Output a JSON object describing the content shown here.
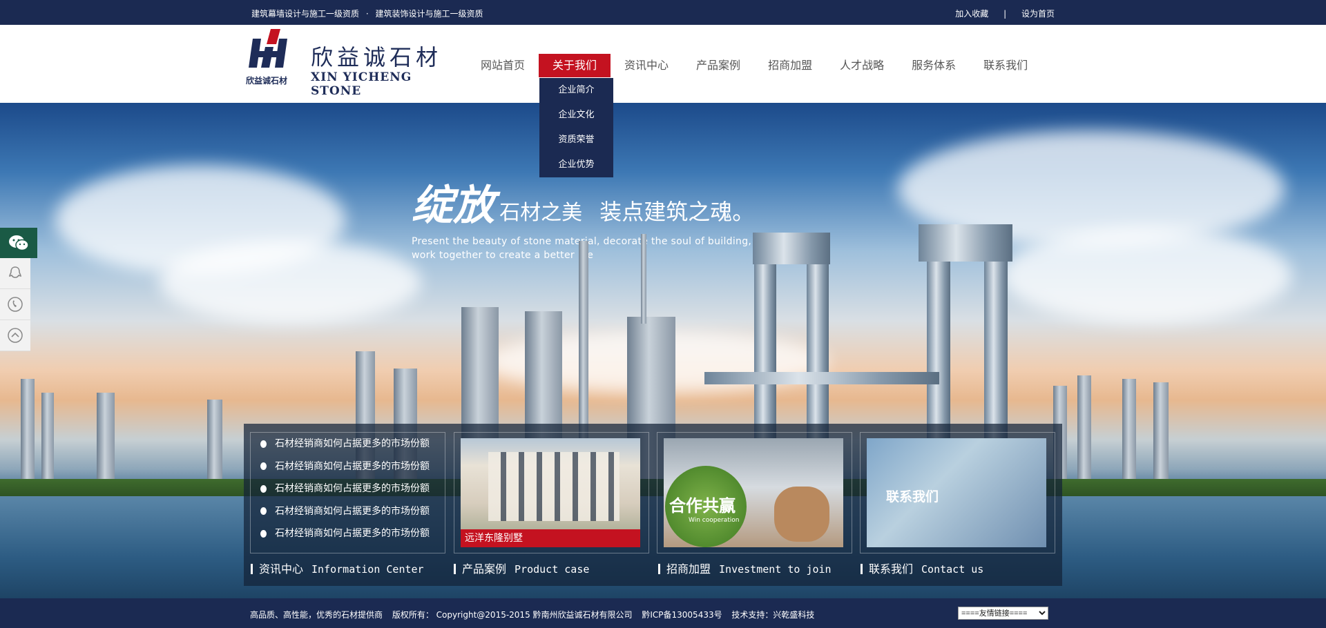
{
  "topbar": {
    "qual1": "建筑幕墙设计与施工一级资质",
    "dot": "·",
    "qual2": "建筑装饰设计与施工一级资质",
    "favorite": "加入收藏",
    "divider": "|",
    "homepage": "设为首页"
  },
  "logo": {
    "cn": "欣益诚石材",
    "en": "XIN YICHENG STONE",
    "sub": "欣益诚石材"
  },
  "nav": {
    "items": [
      "网站首页",
      "关于我们",
      "资讯中心",
      "产品案例",
      "招商加盟",
      "人才战略",
      "服务体系",
      "联系我们"
    ],
    "active_index": 1,
    "dropdown": [
      "企业简介",
      "企业文化",
      "资质荣誉",
      "企业优势"
    ]
  },
  "banner": {
    "slogan_big": "绽放",
    "slogan_1": "石材之美",
    "slogan_2": "装点建筑之魂。",
    "slogan_en1": "Present the beauty of stone material, decorate the soul of building,",
    "slogan_en2": "work together to create a better life"
  },
  "sidefloat": [
    "wechat-icon",
    "qq-icon",
    "phone-icon",
    "back-to-top-icon"
  ],
  "panel": {
    "news": [
      "石材经销商如何占据更多的市场份额",
      "石材经销商如何占据更多的市场份额",
      "石材经销商如何占据更多的市场份额",
      "石材经销商如何占据更多的市场份额",
      "石材经销商如何占据更多的市场份额"
    ],
    "product_caption": "远洋东隆别墅",
    "invest_text": "合作共赢",
    "invest_en": "Win cooperation",
    "contact_caption": "联系我们",
    "labels": [
      {
        "cn": "资讯中心",
        "en": "Information Center"
      },
      {
        "cn": "产品案例",
        "en": "Product case"
      },
      {
        "cn": "招商加盟",
        "en": "Investment to join"
      },
      {
        "cn": "联系我们",
        "en": "Contact us"
      }
    ]
  },
  "footer": {
    "slogan": "高品质、高性能，优秀的石材提供商",
    "copyright": "版权所有： Copyright@2015-2015 黔南州欣益诚石材有限公司",
    "icp": "黔ICP备13005433号",
    "support": "技术支持：兴乾盛科技",
    "links_select": "====友情链接===="
  },
  "colors": {
    "navy": "#1b2a52",
    "red": "#c41220"
  }
}
